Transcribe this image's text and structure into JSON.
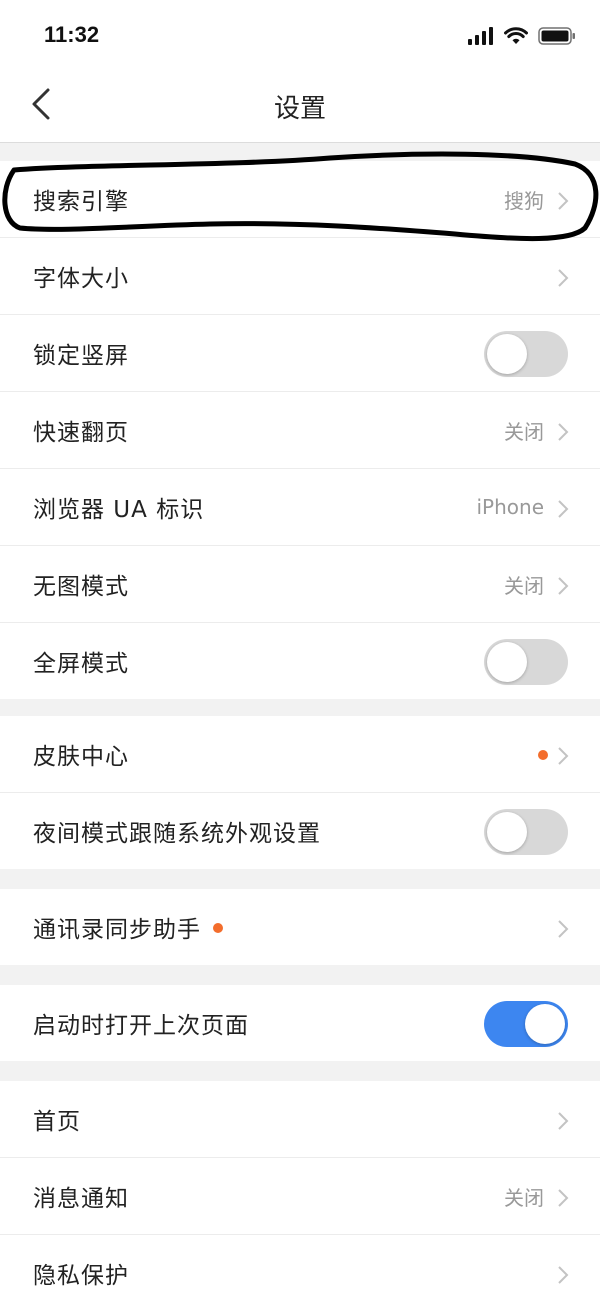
{
  "status": {
    "time": "11:32"
  },
  "nav": {
    "title": "设置"
  },
  "group1": [
    {
      "label": "搜索引擎",
      "value": "搜狗"
    },
    {
      "label": "字体大小",
      "value": ""
    },
    {
      "label": "锁定竖屏",
      "toggle": false
    },
    {
      "label": "快速翻页",
      "value": "关闭"
    },
    {
      "label": "浏览器 UA 标识",
      "value": "iPhone"
    },
    {
      "label": "无图模式",
      "value": "关闭"
    },
    {
      "label": "全屏模式",
      "toggle": false
    }
  ],
  "group2": [
    {
      "label": "皮肤中心",
      "badge": true
    },
    {
      "label": "夜间模式跟随系统外观设置",
      "toggle": false
    }
  ],
  "group3": [
    {
      "label": "通讯录同步助手",
      "badge": true
    }
  ],
  "group4": [
    {
      "label": "启动时打开上次页面",
      "toggle": true
    }
  ],
  "group5": [
    {
      "label": "首页",
      "value": ""
    },
    {
      "label": "消息通知",
      "value": "关闭"
    },
    {
      "label": "隐私保护",
      "value": ""
    }
  ],
  "colors": {
    "accent": "#3d86f0",
    "badge": "#f36d2c",
    "annotation": "#000000"
  }
}
